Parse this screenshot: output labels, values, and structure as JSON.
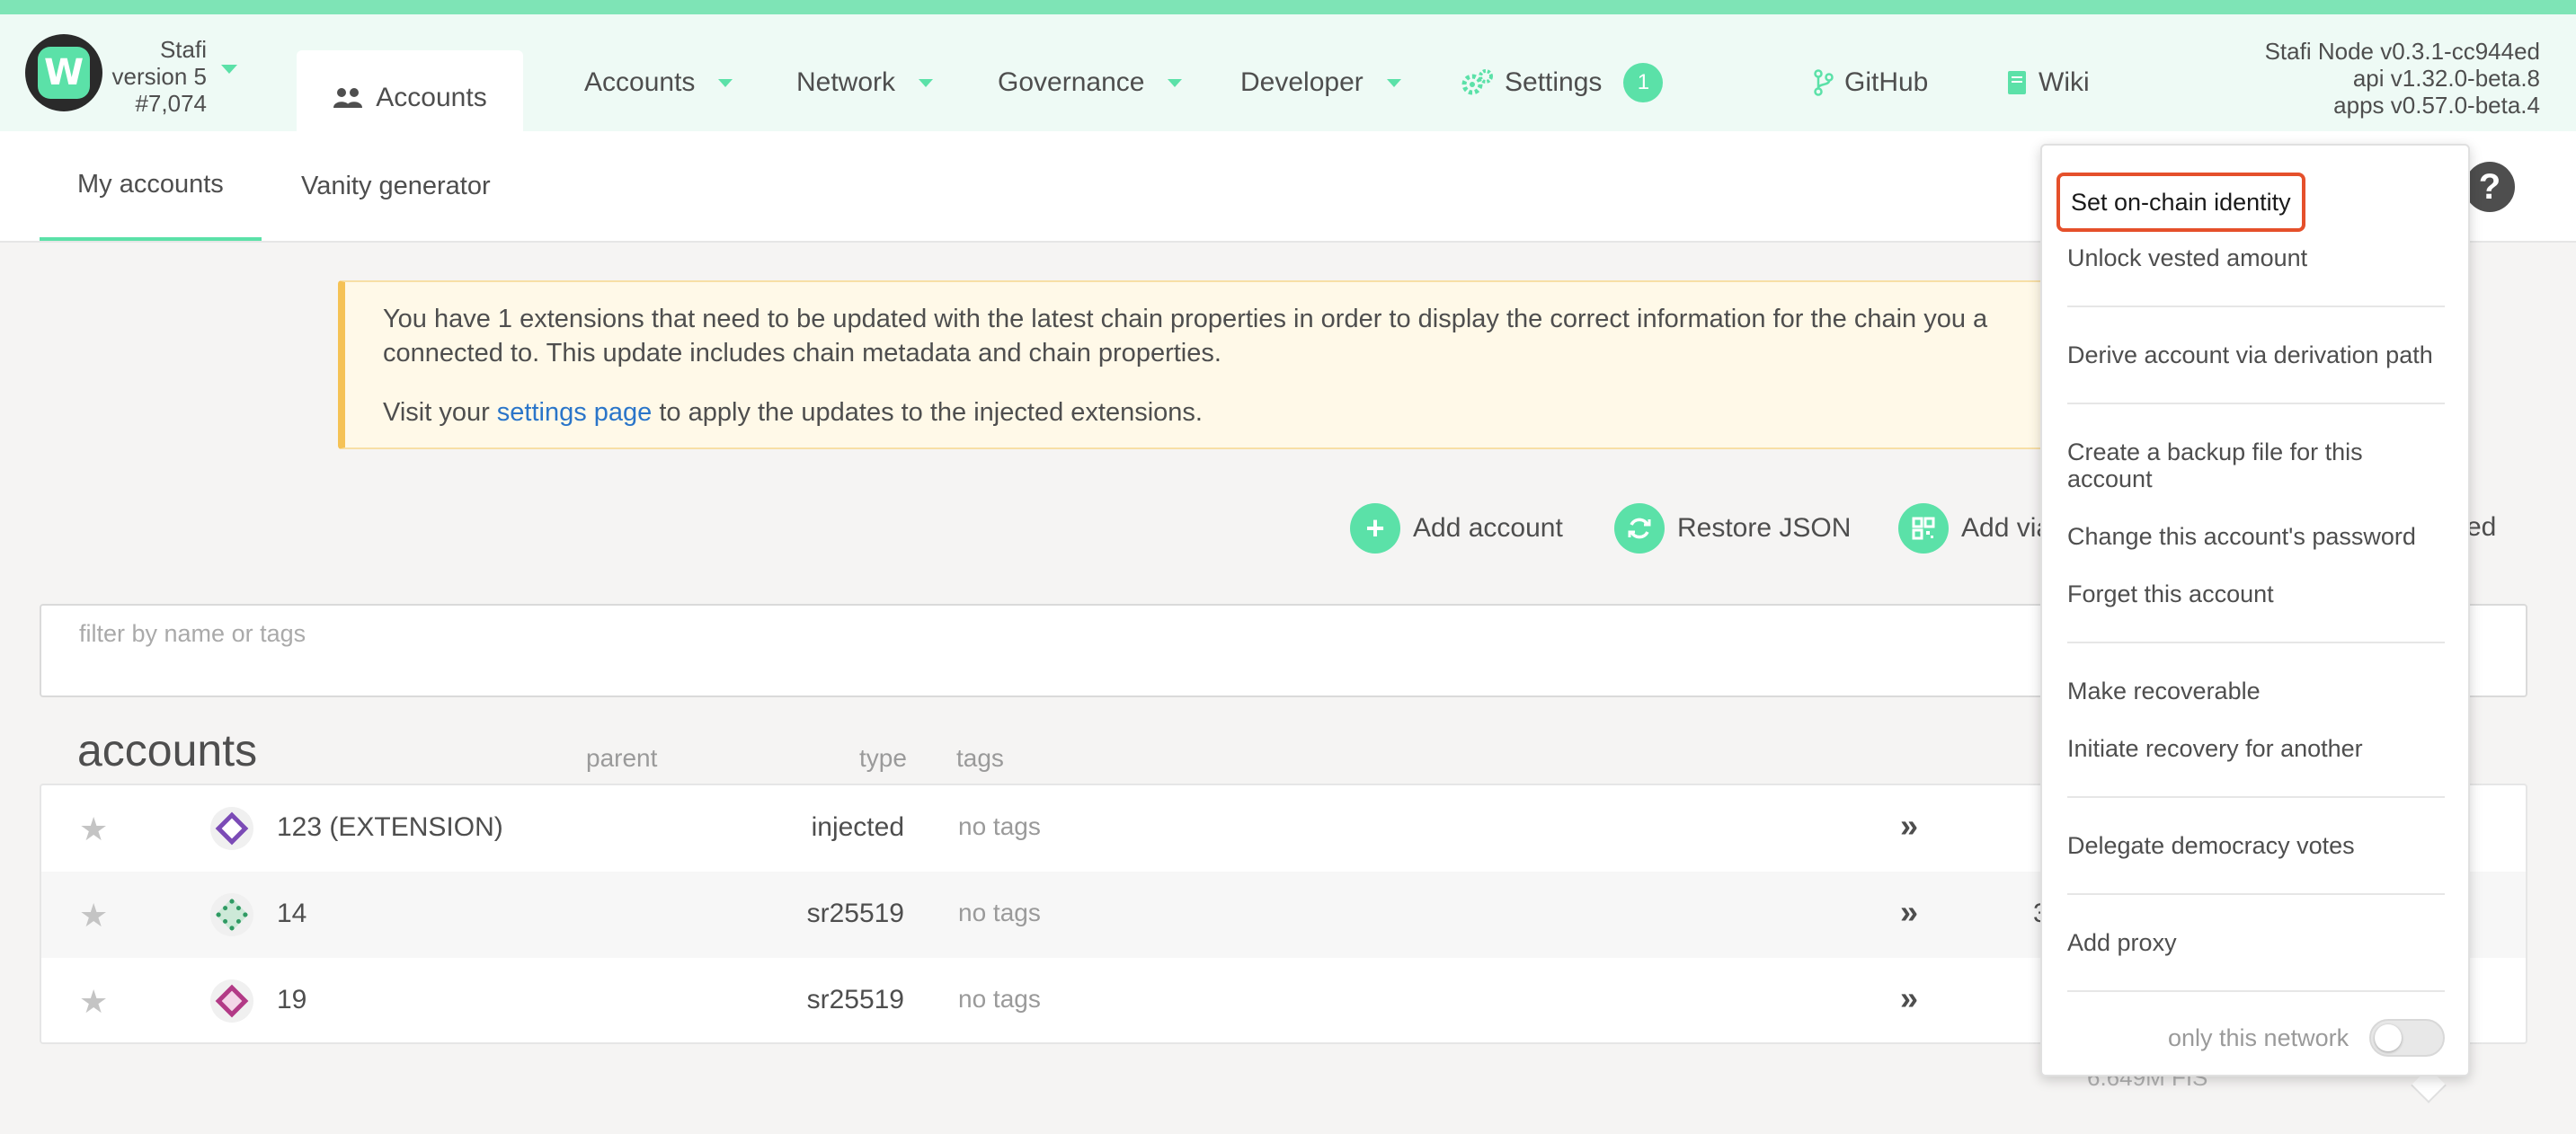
{
  "chain": {
    "name": "Stafi",
    "version": "version 5",
    "block": "#7,074"
  },
  "nav": {
    "active_tab": "Accounts",
    "items": [
      {
        "label": "Accounts"
      },
      {
        "label": "Network"
      },
      {
        "label": "Governance"
      },
      {
        "label": "Developer"
      },
      {
        "label": "Settings",
        "badge": "1"
      }
    ],
    "github": "GitHub",
    "wiki": "Wiki"
  },
  "versions": {
    "node": "Stafi Node v0.3.1-cc944ed",
    "api": "api v1.32.0-beta.8",
    "apps": "apps v0.57.0-beta.4"
  },
  "subtabs": {
    "my_accounts": "My accounts",
    "vanity": "Vanity generator"
  },
  "warning": {
    "line1": "You have 1 extensions that need to be updated with the latest chain properties in order to display the correct information for the chain you a",
    "line2": "connected to. This update includes chain metadata and chain properties.",
    "visit_prefix": "Visit your ",
    "link": "settings page",
    "visit_suffix": " to apply the updates to the injected extensions."
  },
  "actions": {
    "add_account": "Add account",
    "restore_json": "Restore JSON",
    "add_via": "Add via",
    "peek": "ed"
  },
  "filter": {
    "placeholder": "filter by name or tags",
    "value": ""
  },
  "table": {
    "title": "accounts",
    "col_parent": "parent",
    "col_type": "type",
    "col_tags": "tags",
    "rows": [
      {
        "name": "123 (EXTENSION)",
        "type": "injected",
        "tags": "no tags",
        "partial": ""
      },
      {
        "name": "14",
        "type": "sr25519",
        "tags": "no tags",
        "partial": "3"
      },
      {
        "name": "19",
        "type": "sr25519",
        "tags": "no tags",
        "partial": ""
      }
    ],
    "footer_balance": "6.649M FIS"
  },
  "menu": {
    "set_identity": "Set on-chain identity",
    "unlock_vested": "Unlock vested amount",
    "derive": "Derive account via derivation path",
    "backup": "Create a backup file for this account",
    "change_password": "Change this account's password",
    "forget": "Forget this account",
    "make_recoverable": "Make recoverable",
    "initiate_recovery": "Initiate recovery for another",
    "delegate": "Delegate democracy votes",
    "add_proxy": "Add proxy",
    "only_network": "only this network",
    "only_network_on": false
  },
  "colors": {
    "accent": "#5be1a8",
    "highlight_border": "#e5502b",
    "link": "#2a75c9",
    "warning_border": "#f5c255"
  }
}
